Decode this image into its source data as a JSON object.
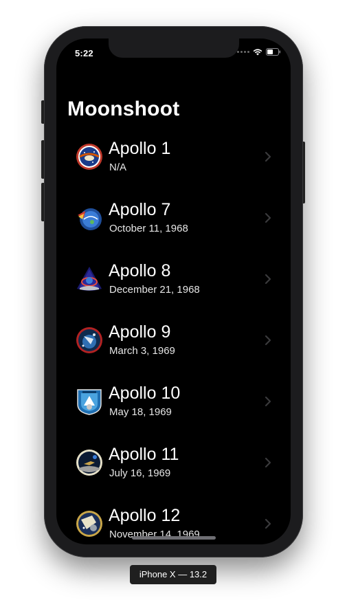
{
  "status_bar": {
    "time": "5:22",
    "icons": [
      "signal-icon",
      "wifi-icon",
      "battery-icon"
    ]
  },
  "nav": {
    "title": "Moonshoot"
  },
  "missions": [
    {
      "name": "Apollo 1",
      "date": "N/A",
      "badge_icon": "apollo-1-patch-icon"
    },
    {
      "name": "Apollo 7",
      "date": "October 11, 1968",
      "badge_icon": "apollo-7-patch-icon"
    },
    {
      "name": "Apollo 8",
      "date": "December 21, 1968",
      "badge_icon": "apollo-8-patch-icon"
    },
    {
      "name": "Apollo 9",
      "date": "March 3, 1969",
      "badge_icon": "apollo-9-patch-icon"
    },
    {
      "name": "Apollo 10",
      "date": "May 18, 1969",
      "badge_icon": "apollo-10-patch-icon"
    },
    {
      "name": "Apollo 11",
      "date": "July 16, 1969",
      "badge_icon": "apollo-11-patch-icon"
    },
    {
      "name": "Apollo 12",
      "date": "November 14, 1969",
      "badge_icon": "apollo-12-patch-icon"
    }
  ],
  "simulator": {
    "device_label": "iPhone X — 13.2"
  },
  "colors": {
    "background": "#000000",
    "text": "#ffffff",
    "chevron": "#3a3a3c",
    "device_frame": "#1c1c1e"
  }
}
